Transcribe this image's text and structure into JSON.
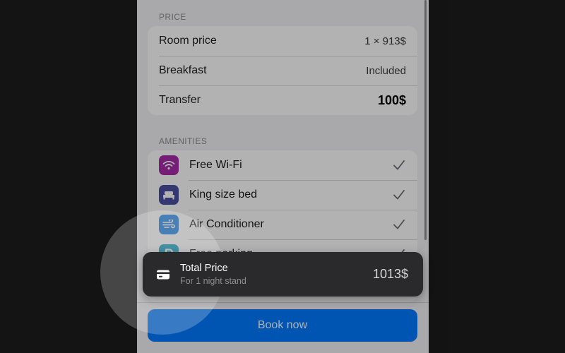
{
  "price_section": {
    "header": "PRICE",
    "rows": [
      {
        "label": "Room price",
        "value": "1 × 913$"
      },
      {
        "label": "Breakfast",
        "value": "Included"
      },
      {
        "label": "Transfer",
        "value": "100$"
      }
    ]
  },
  "amenities_section": {
    "header": "AMENITIES",
    "items": [
      {
        "label": "Free Wi-Fi",
        "icon": "wifi-icon",
        "color": "#a82ba8",
        "checked": true
      },
      {
        "label": "King size bed",
        "icon": "bed-icon",
        "color": "#4b4fa3",
        "checked": true
      },
      {
        "label": "Air Conditioner",
        "icon": "wind-icon",
        "color": "#1f86e8",
        "checked": true
      },
      {
        "label": "Free parking",
        "icon": "parking-icon",
        "color": "#13a4c9",
        "checked": true
      }
    ]
  },
  "toast": {
    "icon": "credit-card-icon",
    "title": "Total Price",
    "subtitle": "For 1 night stand",
    "price": "1013$"
  },
  "footer": {
    "book_label": "Book now"
  },
  "colors": {
    "accent": "#007aff",
    "background": "#f2f2f7",
    "toast_bg": "#2a2a2c"
  }
}
